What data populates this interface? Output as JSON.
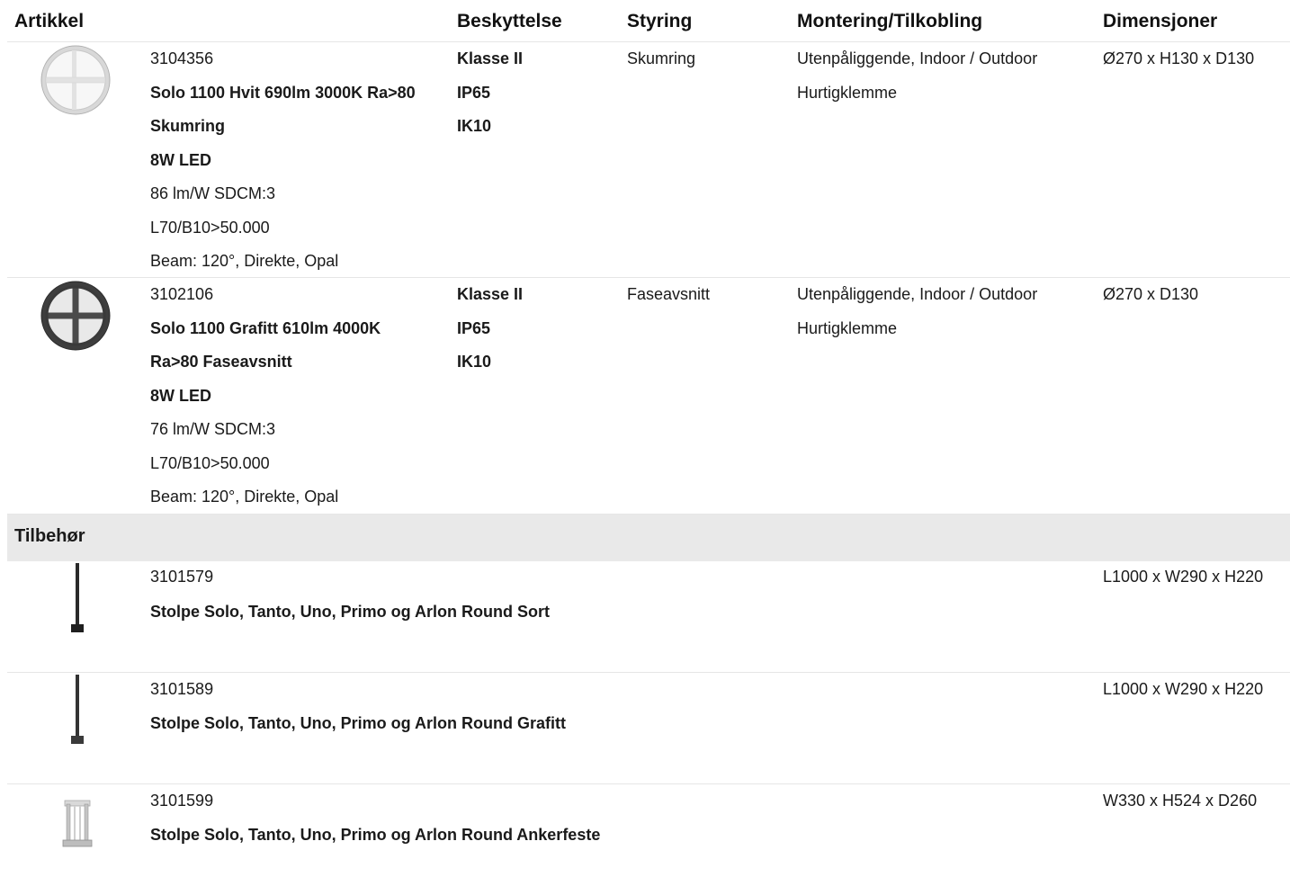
{
  "headers": {
    "artikkel": "Artikkel",
    "beskyttelse": "Beskyttelse",
    "styring": "Styring",
    "montering": "Montering/Tilkobling",
    "dimensjoner": "Dimensjoner"
  },
  "products": [
    {
      "id": "3104356",
      "name1": "Solo 1100 Hvit 690lm 3000K Ra>80",
      "name2": "Skumring",
      "power": "8W LED",
      "efficacy": "86 lm/W SDCM:3",
      "lifetime": "L70/B10>50.000",
      "beam": "Beam: 120°, Direkte, Opal",
      "prot1": "Klasse II",
      "prot2": "IP65",
      "prot3": "IK10",
      "styring": "Skumring",
      "mont1": "Utenpåliggende, Indoor / Outdoor",
      "mont2": "Hurtigklemme",
      "dim": "Ø270 x H130 x D130",
      "icon": "white-bulkhead-light-icon",
      "color": "#f2f2f2"
    },
    {
      "id": "3102106",
      "name1": "Solo 1100 Grafitt 610lm 4000K",
      "name2": "Ra>80 Faseavsnitt",
      "power": "8W LED",
      "efficacy": "76 lm/W SDCM:3",
      "lifetime": "L70/B10>50.000",
      "beam": "Beam: 120°, Direkte, Opal",
      "prot1": "Klasse II",
      "prot2": "IP65",
      "prot3": "IK10",
      "styring": "Faseavsnitt",
      "mont1": "Utenpåliggende, Indoor / Outdoor",
      "mont2": "Hurtigklemme",
      "dim": "Ø270 x D130",
      "icon": "graphite-bulkhead-light-icon",
      "color": "#4a4a4a"
    }
  ],
  "accessories_title": "Tilbehør",
  "accessories": [
    {
      "id": "3101579",
      "name": "Stolpe Solo, Tanto, Uno, Primo og Arlon Round Sort",
      "dim": "L1000 x W290 x H220",
      "icon": "black-post-icon"
    },
    {
      "id": "3101589",
      "name": "Stolpe Solo, Tanto, Uno, Primo og Arlon Round Grafitt",
      "dim": "L1000 x W290 x H220",
      "icon": "graphite-post-icon"
    },
    {
      "id": "3101599",
      "name": "Stolpe Solo, Tanto, Uno, Primo og Arlon Round Ankerfeste",
      "dim": "W330 x H524 x D260",
      "icon": "anchor-bracket-icon"
    }
  ]
}
